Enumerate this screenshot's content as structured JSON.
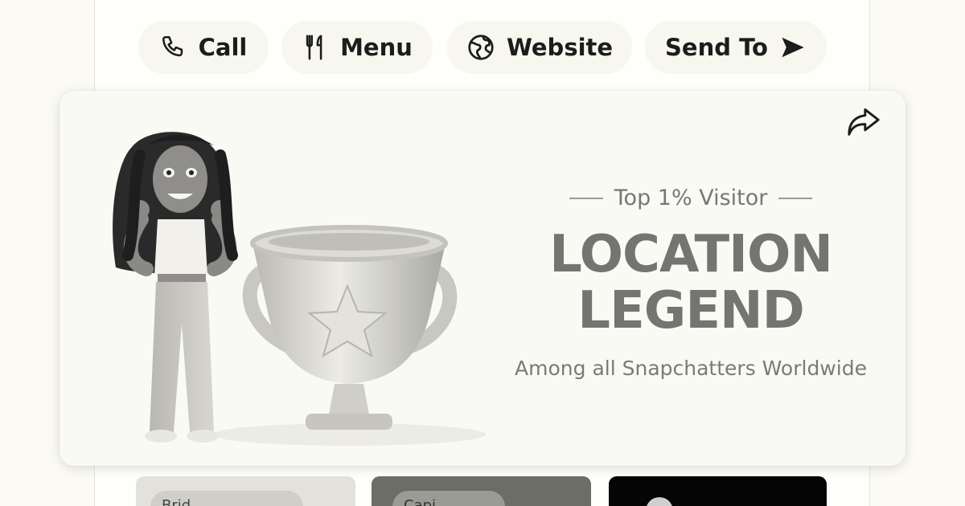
{
  "actions": {
    "call": {
      "label": "Call",
      "icon": "phone-icon"
    },
    "menu": {
      "label": "Menu",
      "icon": "fork-knife-icon"
    },
    "website": {
      "label": "Website",
      "icon": "globe-icon"
    },
    "send": {
      "label": "Send To",
      "icon": "send-arrow-icon"
    }
  },
  "card": {
    "kicker": "Top 1% Visitor",
    "headline_line1": "LOCATION",
    "headline_line2": "LEGEND",
    "subtitle": "Among all Snapchatters Worldwide",
    "share_icon": "share-icon",
    "illustration": "bitmoji-with-trophy"
  },
  "tiles": [
    {
      "label": "Brid..."
    },
    {
      "label": "Capi..."
    },
    {
      "label": ""
    }
  ],
  "colors": {
    "background": "#fbfaf3",
    "card": "#fafaf4",
    "headline": "#747471",
    "text": "#1c1c1c"
  }
}
